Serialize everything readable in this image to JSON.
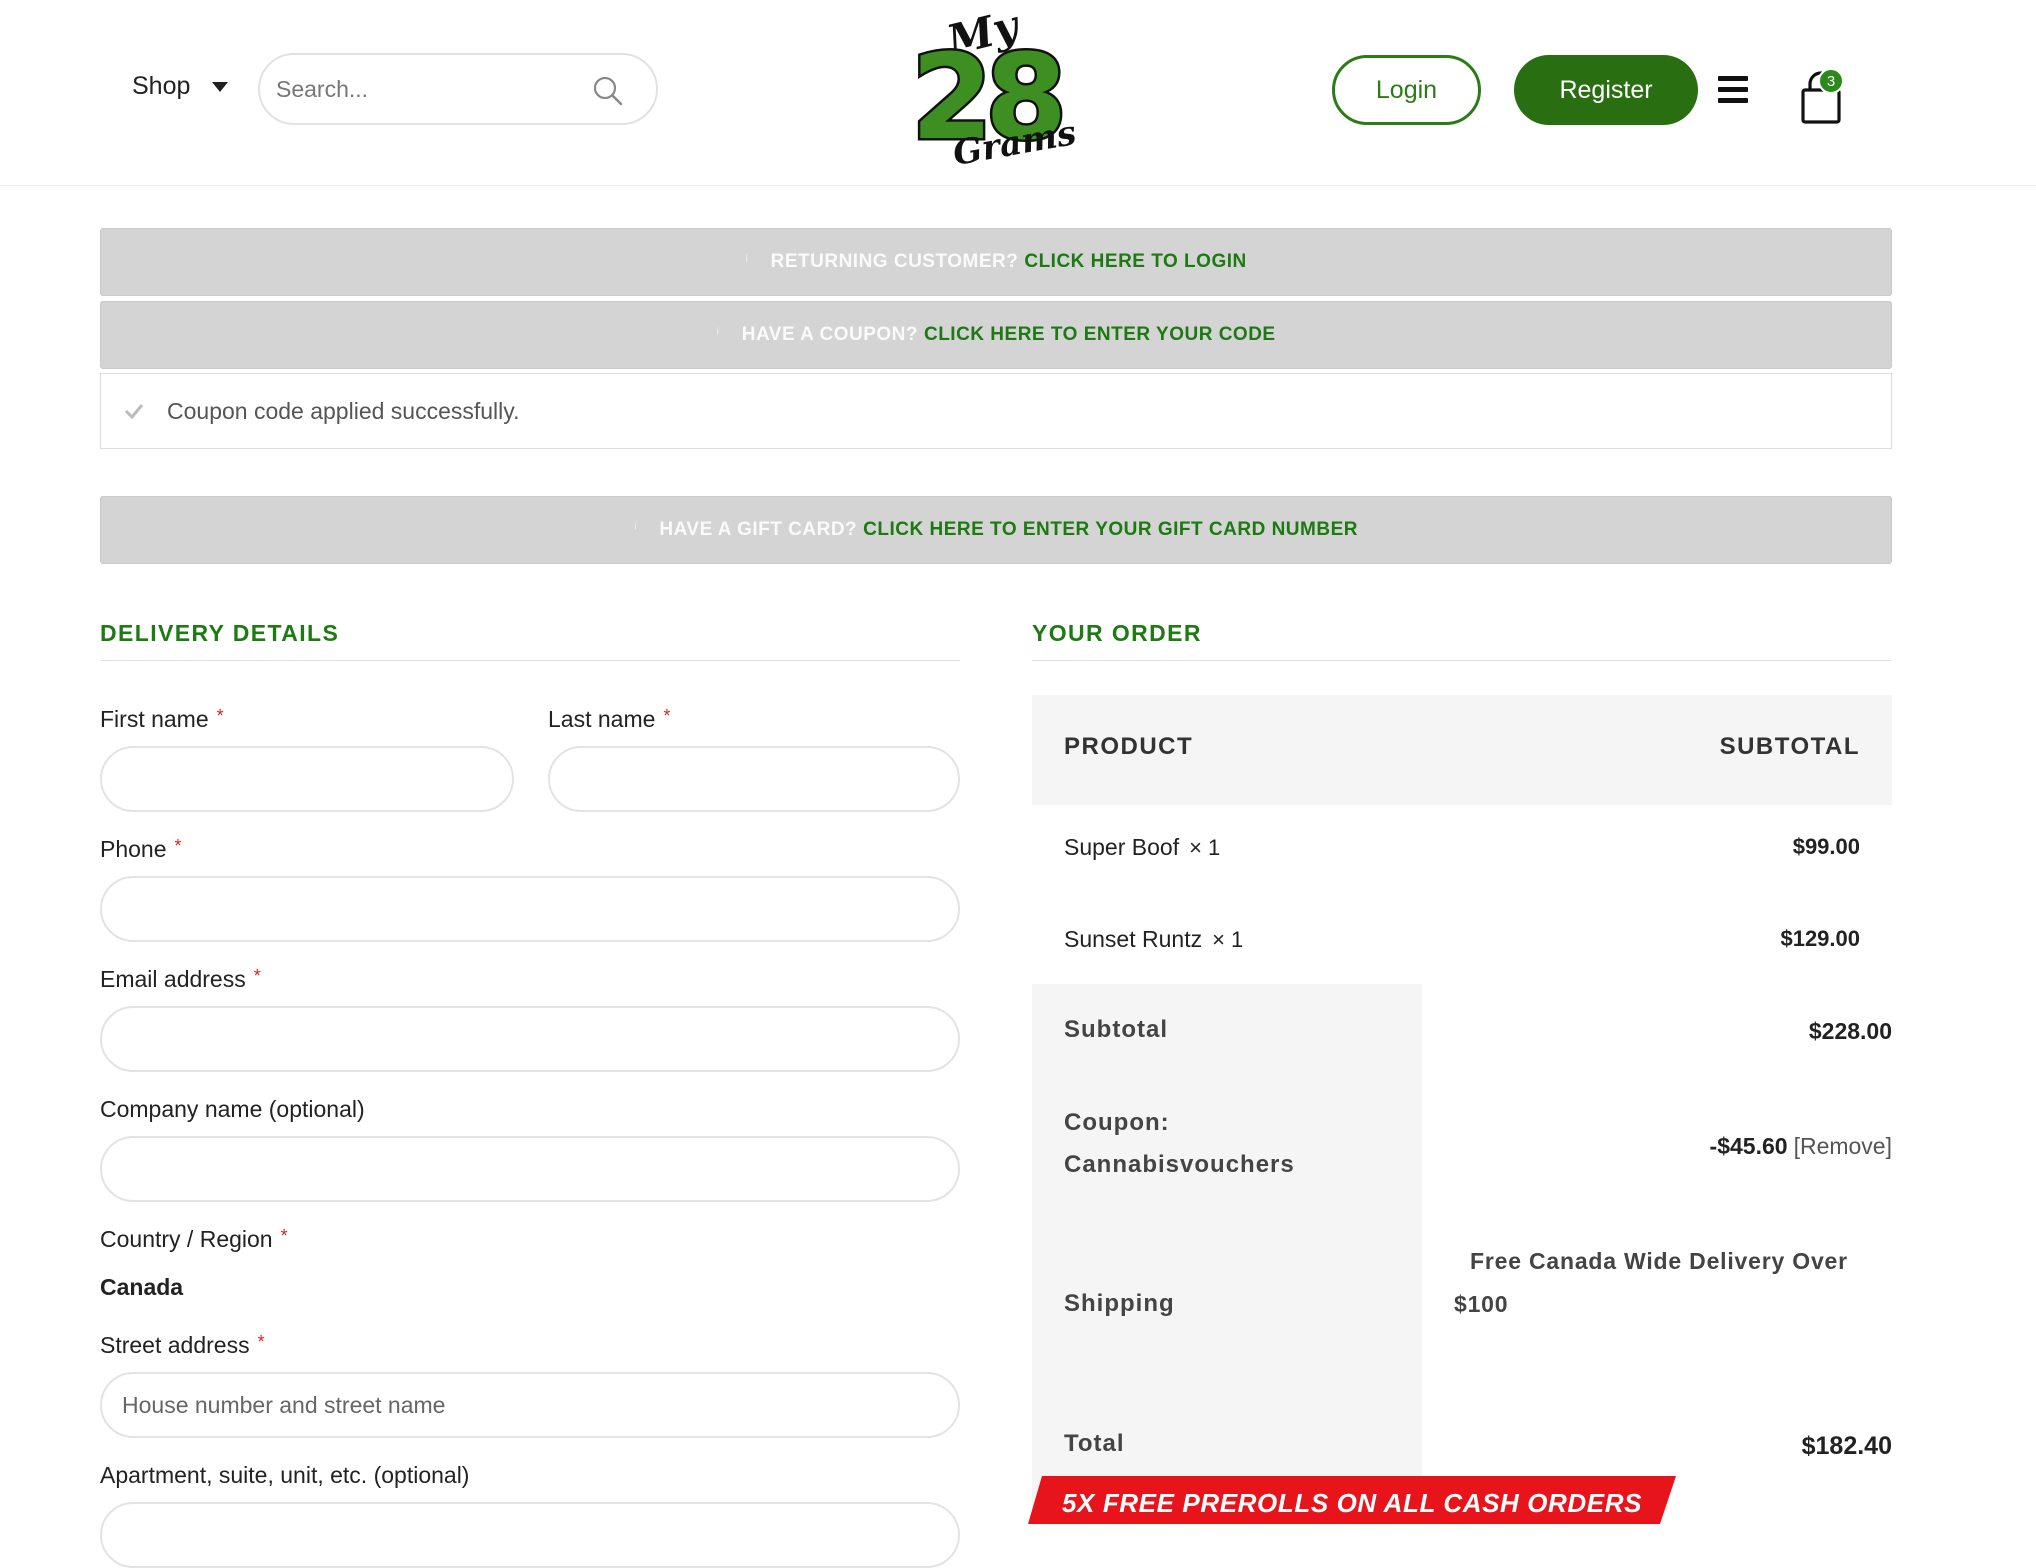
{
  "header": {
    "shop_label": "Shop",
    "search_placeholder": "Search...",
    "login_label": "Login",
    "register_label": "Register",
    "cart_count": "3",
    "logo_alt": "My 28 Grams"
  },
  "notices": {
    "returning_lead": "RETURNING CUSTOMER?",
    "returning_link": "CLICK HERE TO LOGIN",
    "coupon_lead": "HAVE A COUPON?",
    "coupon_link": "CLICK HERE TO ENTER YOUR CODE",
    "coupon_success": "Coupon code applied successfully.",
    "giftcard_lead": "HAVE A GIFT CARD?",
    "giftcard_link": "CLICK HERE TO ENTER YOUR GIFT CARD NUMBER"
  },
  "delivery": {
    "title": "DELIVERY DETAILS",
    "first_name": "First name",
    "last_name": "Last name",
    "phone": "Phone",
    "email": "Email address",
    "company": "Company name (optional)",
    "country_label": "Country / Region",
    "country_value": "Canada",
    "street_label": "Street address",
    "street_placeholder": "House number and street name",
    "apartment_label": "Apartment, suite, unit, etc. (optional)",
    "required_mark": "*"
  },
  "order": {
    "title": "YOUR ORDER",
    "col_product": "PRODUCT",
    "col_subtotal": "SUBTOTAL",
    "items": [
      {
        "name": "Super Boof",
        "qty": "× 1",
        "price": "$99.00"
      },
      {
        "name": "Sunset Runtz",
        "qty": "× 1",
        "price": "$129.00"
      }
    ],
    "subtotal_label": "Subtotal",
    "subtotal_value": "$228.00",
    "coupon_label": "Coupon:",
    "coupon_code": "Cannabisvouchers",
    "coupon_value": "-$45.60",
    "coupon_remove": "[Remove]",
    "shipping_label": "Shipping",
    "shipping_value": "Free Canada Wide Delivery Over $100",
    "total_label": "Total",
    "total_value": "$182.40"
  },
  "promo": {
    "text": "5X FREE PREROLLS ON ALL CASH ORDERS"
  },
  "colors": {
    "brand_green": "#2a6e12",
    "link_green": "#1d7a12",
    "promo_red": "#e8141c",
    "notice_gray": "#d4d4d4"
  }
}
